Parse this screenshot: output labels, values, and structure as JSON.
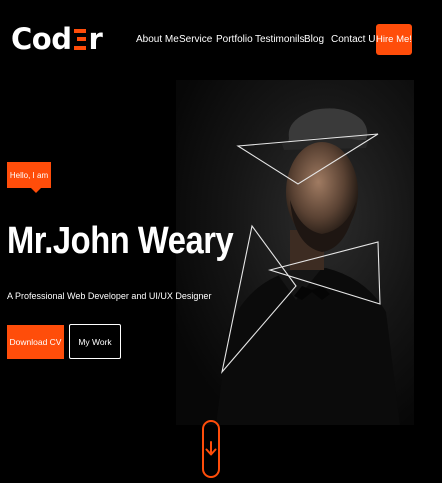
{
  "brand": {
    "logo_left": "Cod",
    "logo_right": "r",
    "accent": "#ff4d0a"
  },
  "nav": {
    "items": [
      "About Me",
      "Service",
      "Portfolio",
      "Testimonils",
      "Blog",
      "Contact Us"
    ],
    "cta": "Hire Me!"
  },
  "hero": {
    "badge": "Hello, I am",
    "name": "Mr.John Weary",
    "tagline": "A Professional Web Developer and UI/UX Designer",
    "primary_button": "Download CV",
    "secondary_button": "My Work"
  },
  "icons": {
    "scroll": "arrow-down-icon"
  }
}
